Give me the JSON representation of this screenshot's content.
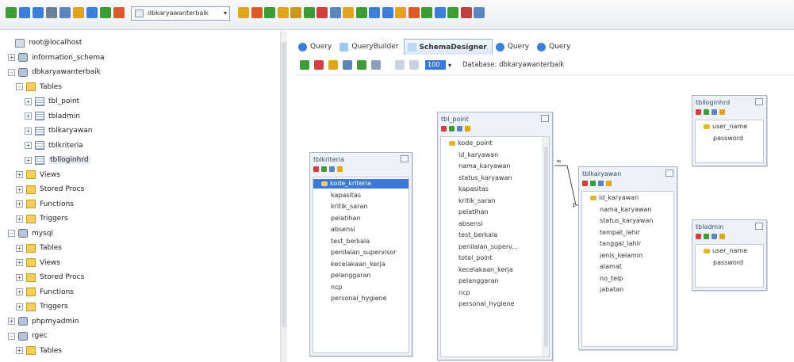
{
  "toolbar": {
    "database_select": "dbkaryawanterbaik",
    "icon_colors": [
      "#3f9b35",
      "#3d7fd6",
      "#3d7fd6",
      "#6b7f99",
      "#5d85bd",
      "#e0a51c",
      "#3d7fd6",
      "#3f9b35",
      "#d95a2b",
      "#e0a51c",
      "#d95a2b",
      "#3f9b35",
      "#e0a51c",
      "#c9981f",
      "#3f9b35",
      "#d04040",
      "#5d85bd",
      "#e0a51c",
      "#3f9b35",
      "#3d7fd6",
      "#3d7fd6",
      "#e0a51c",
      "#d95a2b",
      "#3f9b35",
      "#3d7fd6",
      "#3f9b35",
      "#c04040",
      "#5d85bd"
    ]
  },
  "tree": {
    "items": [
      {
        "label": "root@localhost",
        "expander": "",
        "icon": "server"
      },
      {
        "label": "information_schema",
        "expander": "+",
        "icon": "db"
      },
      {
        "label": "dbkaryawanterbaik",
        "expander": "-",
        "icon": "db"
      },
      {
        "label": "Tables",
        "expander": "-",
        "icon": "folder"
      },
      {
        "label": "tbl_point",
        "expander": "+",
        "icon": "table"
      },
      {
        "label": "tbladmin",
        "expander": "+",
        "icon": "table"
      },
      {
        "label": "tblkaryawan",
        "expander": "+",
        "icon": "table"
      },
      {
        "label": "tblkriteria",
        "expander": "+",
        "icon": "table"
      },
      {
        "label": "tblloginhrd",
        "expander": "+",
        "icon": "table"
      },
      {
        "label": "Views",
        "expander": "+",
        "icon": "folder"
      },
      {
        "label": "Stored Procs",
        "expander": "+",
        "icon": "folder"
      },
      {
        "label": "Functions",
        "expander": "+",
        "icon": "folder"
      },
      {
        "label": "Triggers",
        "expander": "+",
        "icon": "folder"
      },
      {
        "label": "mysql",
        "expander": "-",
        "icon": "db"
      },
      {
        "label": "Tables",
        "expander": "+",
        "icon": "folder"
      },
      {
        "label": "Views",
        "expander": "+",
        "icon": "folder"
      },
      {
        "label": "Stored Procs",
        "expander": "+",
        "icon": "folder"
      },
      {
        "label": "Functions",
        "expander": "+",
        "icon": "folder"
      },
      {
        "label": "Triggers",
        "expander": "+",
        "icon": "folder"
      },
      {
        "label": "phpmyadmin",
        "expander": "+",
        "icon": "db"
      },
      {
        "label": "rgec",
        "expander": "-",
        "icon": "db"
      },
      {
        "label": "Tables",
        "expander": "+",
        "icon": "folder"
      }
    ]
  },
  "tabs": [
    {
      "label": "Query",
      "icon": "query"
    },
    {
      "label": "QueryBuilder",
      "icon": "querybuilder"
    },
    {
      "label": "SchemaDesigner",
      "icon": "schemadesigner"
    },
    {
      "label": "Query",
      "icon": "query"
    },
    {
      "label": "Query",
      "icon": "query"
    }
  ],
  "designer": {
    "zoom_value": "100",
    "database_label": "Database: dbkaryawanterbaik"
  },
  "tables": [
    {
      "name": "tblkriteria",
      "key_field": "kode_kriteria",
      "fields": [
        "kapasitas",
        "kritik_saran",
        "pelatihan",
        "absensi",
        "test_berkala",
        "penilaian_supervisor",
        "kecelakaan_kerja",
        "pelanggaran",
        "ncp",
        "personal_hygiene"
      ]
    },
    {
      "name": "tbl_point",
      "key_field": "kode_point",
      "fields": [
        "id_karyawan",
        "nama_karyawan",
        "status_karyawan",
        "kapasitas",
        "kritik_saran",
        "pelatihan",
        "absensi",
        "test_berkala",
        "penilaian_superv...",
        "total_point",
        "kecelakaan_kerja",
        "pelanggaran",
        "ncp",
        "personal_hygiene"
      ]
    },
    {
      "name": "tblkaryawan",
      "key_field": "id_karyawan",
      "fields": [
        "nama_karyawan",
        "status_karyawan",
        "tempat_lahir",
        "tanggal_lahir",
        "jenis_kelamin",
        "alamat",
        "no_telp",
        "jabatan"
      ]
    },
    {
      "name": "tblloginhrd",
      "key_field": "user_name",
      "fields": [
        "password"
      ]
    },
    {
      "name": "tbladmin",
      "key_field": "user_name",
      "fields": [
        "password"
      ]
    }
  ],
  "relation": {
    "from_label": "∞",
    "to_label": "1"
  }
}
